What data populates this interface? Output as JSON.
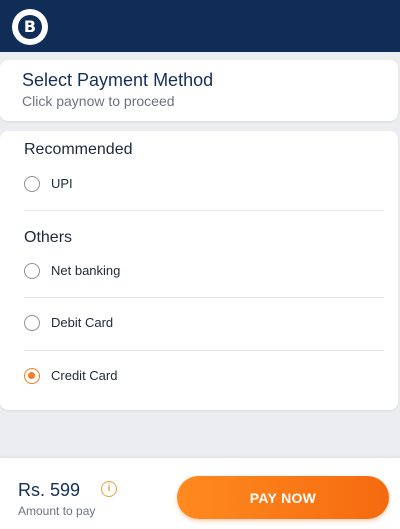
{
  "header": {
    "logo_letter": "B",
    "title": "Select Payment Method",
    "subtitle": "Click paynow to proceed"
  },
  "sections": {
    "recommended": {
      "title": "Recommended",
      "options": [
        {
          "label": "UPI",
          "selected": false
        }
      ]
    },
    "others": {
      "title": "Others",
      "options": [
        {
          "label": "Net banking",
          "selected": false
        },
        {
          "label": "Debit Card",
          "selected": false
        },
        {
          "label": "Credit Card",
          "selected": true
        }
      ]
    }
  },
  "footer": {
    "amount": "Rs. 599",
    "info_symbol": "i",
    "amount_label": "Amount to pay",
    "pay_button_label": "PAY NOW"
  },
  "colors": {
    "topbar": "#0f2d56",
    "accent_orange": "#f57c1f",
    "title_navy": "#152f58"
  }
}
